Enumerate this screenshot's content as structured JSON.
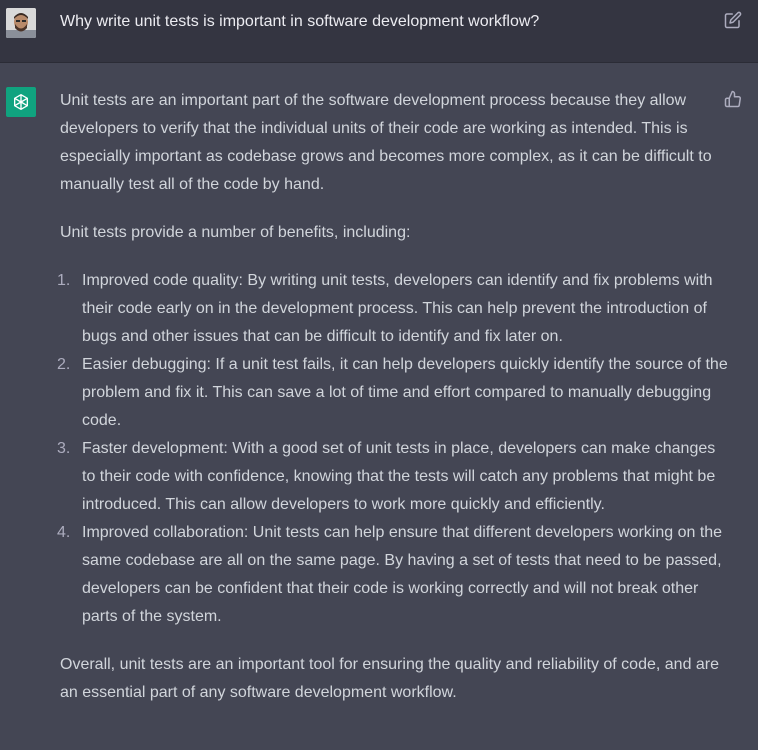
{
  "user_message": {
    "text": "Why write unit tests is important in software development workflow?",
    "edit_icon": "edit-icon"
  },
  "assistant_message": {
    "avatar_icon": "openai-logo-icon",
    "feedback_icon": "thumbs-up-icon",
    "intro": "Unit tests are an important part of the software development process because they allow developers to verify that the individual units of their code are working as intended. This is especially important as codebase grows and becomes more complex, as it can be difficult to manually test all of the code by hand.",
    "benefits_intro": "Unit tests provide a number of benefits, including:",
    "benefits": [
      {
        "number": "1.",
        "text": "Improved code quality: By writing unit tests, developers can identify and fix problems with their code early on in the development process. This can help prevent the introduction of bugs and other issues that can be difficult to identify and fix later on."
      },
      {
        "number": "2.",
        "text": "Easier debugging: If a unit test fails, it can help developers quickly identify the source of the problem and fix it. This can save a lot of time and effort compared to manually debugging code."
      },
      {
        "number": "3.",
        "text": "Faster development: With a good set of unit tests in place, developers can make changes to their code with confidence, knowing that the tests will catch any problems that might be introduced. This can allow developers to work more quickly and efficiently."
      },
      {
        "number": "4.",
        "text": "Improved collaboration: Unit tests can help ensure that different developers working on the same codebase are all on the same page. By having a set of tests that need to be passed, developers can be confident that their code is working correctly and will not break other parts of the system."
      }
    ],
    "closing": "Overall, unit tests are an important tool for ensuring the quality and reliability of code, and are an essential part of any software development workflow."
  },
  "colors": {
    "user_bg": "#343541",
    "assistant_bg": "#444654",
    "brand_green": "#10a37f",
    "text": "#d1d5db"
  }
}
